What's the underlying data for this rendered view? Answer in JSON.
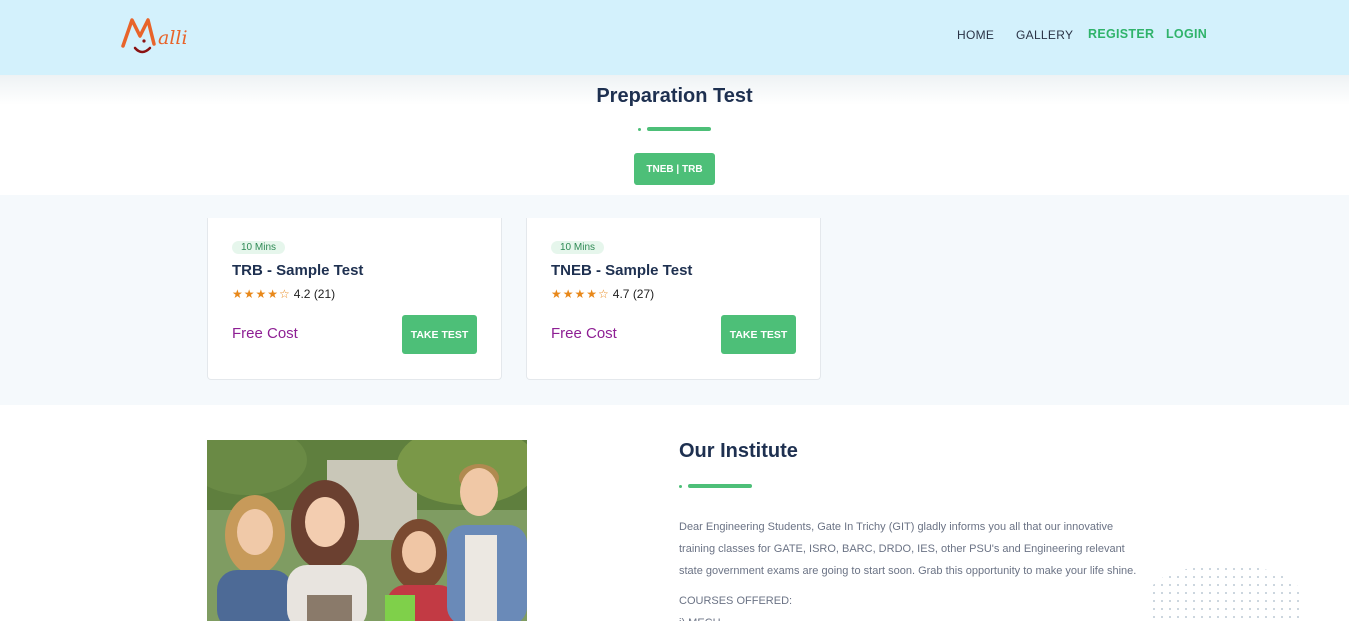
{
  "header": {
    "logo_text": "Malli",
    "nav": [
      "HOME",
      "GALLERY",
      "REGISTER",
      "LOGIN"
    ]
  },
  "preparation": {
    "title": "Preparation Test",
    "filter_label": "TNEB | TRB"
  },
  "cards": [
    {
      "duration": "10 Mins",
      "title": "TRB - Sample Test",
      "stars": "★★★★☆",
      "rating": "4.2 (21)",
      "price": "Free Cost",
      "button": "TAKE TEST"
    },
    {
      "duration": "10 Mins",
      "title": "TNEB - Sample Test",
      "stars": "★★★★☆",
      "rating": "4.7 (27)",
      "price": "Free Cost",
      "button": "TAKE TEST"
    }
  ],
  "institute": {
    "title": "Our Institute",
    "paragraph": "Dear Engineering Students, Gate In Trichy (GIT) gladly informs you all that our innovative training classes for GATE, ISRO, BARC, DRDO, IES, other PSU's and Engineering relevant state government exams are going to start soon. Grab this opportunity to make your life shine.",
    "courses_heading": "COURSES OFFERED:",
    "course_1": "i) MECH"
  },
  "colors": {
    "header_bg": "#d3f1fc",
    "accent_green": "#4dbf78",
    "price_purple": "#8e1f94"
  },
  "icons": [
    "logo-icon",
    "star-icon"
  ]
}
